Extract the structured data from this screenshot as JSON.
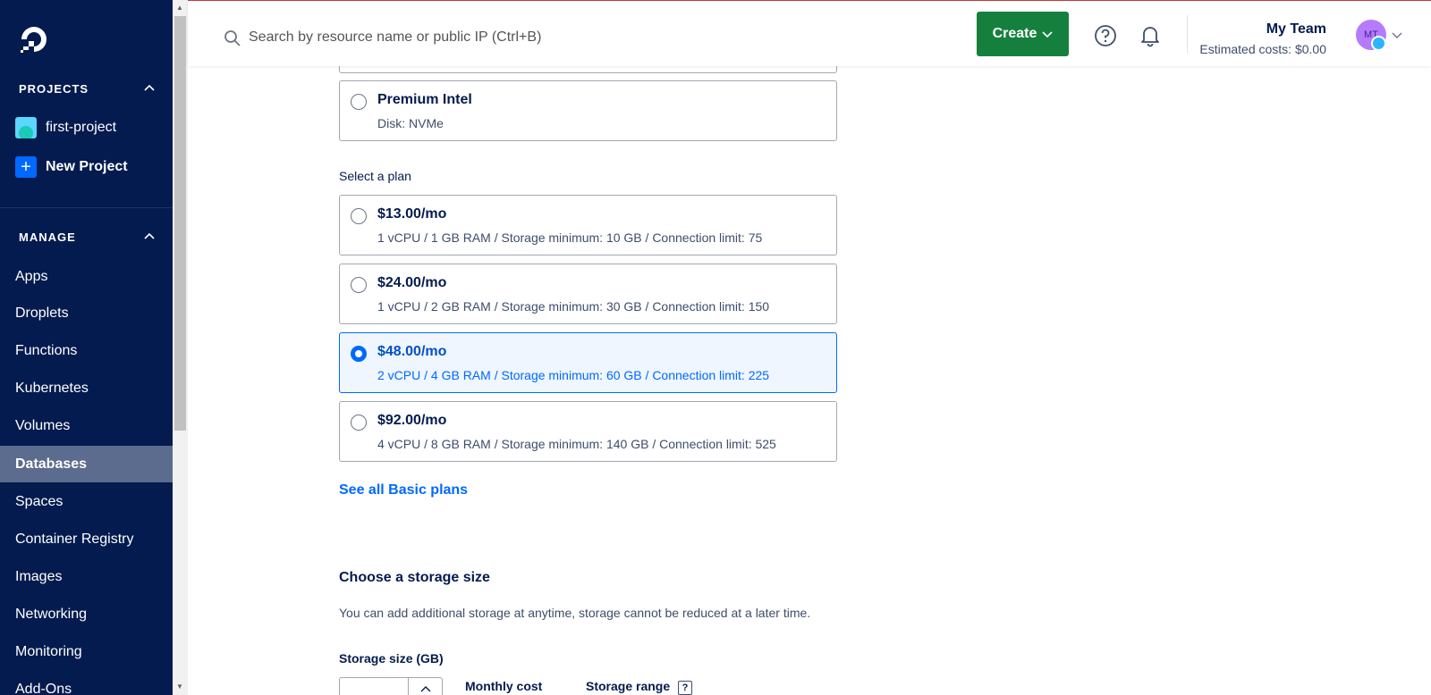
{
  "sidebar": {
    "projects_heading": "PROJECTS",
    "projects": [
      {
        "label": "first-project",
        "icon": "project-avatar-icon"
      },
      {
        "label": "New Project",
        "icon": "plus-icon"
      }
    ],
    "manage_heading": "MANAGE",
    "nav": [
      {
        "label": "Apps"
      },
      {
        "label": "Droplets"
      },
      {
        "label": "Functions"
      },
      {
        "label": "Kubernetes"
      },
      {
        "label": "Volumes"
      },
      {
        "label": "Databases",
        "active": true
      },
      {
        "label": "Spaces"
      },
      {
        "label": "Container Registry"
      },
      {
        "label": "Images"
      },
      {
        "label": "Networking"
      },
      {
        "label": "Monitoring"
      },
      {
        "label": "Add-Ons"
      }
    ]
  },
  "header": {
    "search_placeholder": "Search by resource name or public IP (Ctrl+B)",
    "create_label": "Create",
    "team_name": "My Team",
    "estimated_costs": "Estimated costs: $0.00",
    "avatar_initials": "MT"
  },
  "cpu_option": {
    "title": "Premium Intel",
    "sub": "Disk: NVMe"
  },
  "plan_section_label": "Select a plan",
  "plans": [
    {
      "price": "$13.00/mo",
      "specs": "1 vCPU / 1 GB RAM / Storage minimum: 10 GB / Connection limit: 75",
      "selected": false
    },
    {
      "price": "$24.00/mo",
      "specs": "1 vCPU / 2 GB RAM / Storage minimum: 30 GB / Connection limit: 150",
      "selected": false
    },
    {
      "price": "$48.00/mo",
      "specs": "2 vCPU / 4 GB RAM / Storage minimum: 60 GB / Connection limit: 225",
      "selected": true
    },
    {
      "price": "$92.00/mo",
      "specs": "4 vCPU / 8 GB RAM / Storage minimum: 140 GB / Connection limit: 525",
      "selected": false
    }
  ],
  "see_all_link": "See all Basic plans",
  "storage": {
    "heading": "Choose a storage size",
    "description": "You can add additional storage at anytime, storage cannot be reduced at a later time.",
    "size_label": "Storage size (GB)",
    "monthly_cost_label": "Monthly cost",
    "storage_range_label": "Storage range",
    "help_glyph": "?"
  },
  "colors": {
    "sidebar_bg": "#031b4e",
    "active_nav_bg": "#5b6c8e",
    "create_button": "#15803d",
    "accent_blue": "#0069ff"
  }
}
